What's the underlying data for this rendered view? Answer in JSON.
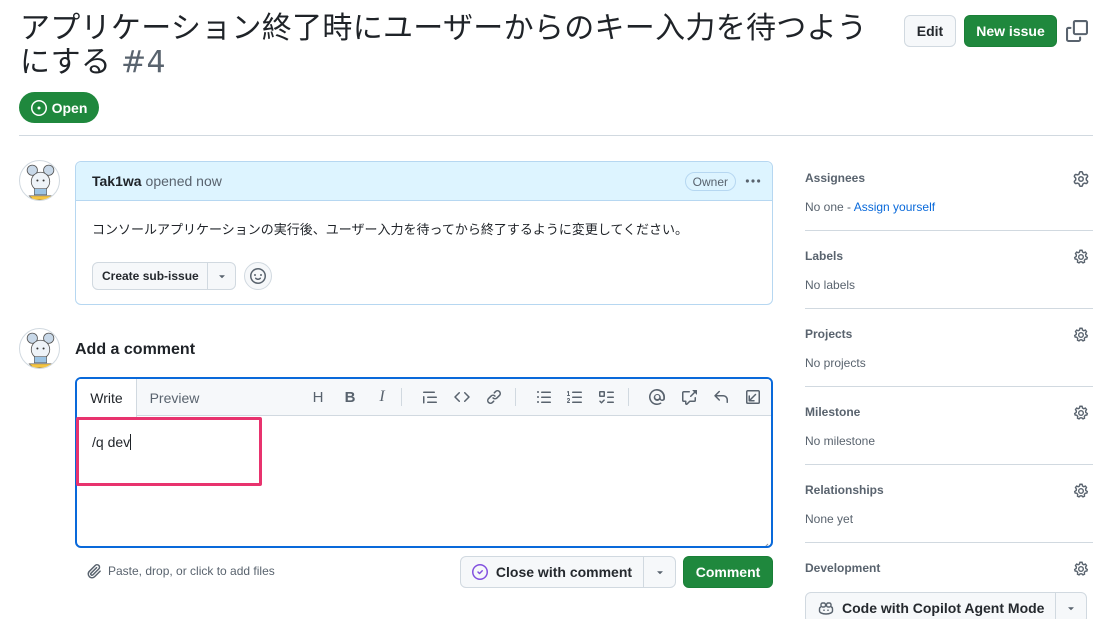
{
  "header": {
    "title": "アプリケーション終了時にユーザーからのキー入力を待つようにする",
    "issue_number": "#4",
    "edit_label": "Edit",
    "new_issue_label": "New issue",
    "state": "Open"
  },
  "comment": {
    "author": "Tak1wa",
    "meta": "opened now",
    "badge": "Owner",
    "body": "コンソールアプリケーションの実行後、ユーザー入力を待ってから終了するように変更してください。",
    "subissue_label": "Create sub-issue"
  },
  "composer": {
    "title": "Add a comment",
    "tabs": [
      "Write",
      "Preview"
    ],
    "toolbar_heading": "H",
    "toolbar_bold": "B",
    "toolbar_italic": "I",
    "text": "/q dev",
    "attach_hint": "Paste, drop, or click to add files",
    "close_label": "Close with comment",
    "comment_label": "Comment"
  },
  "sidebar": {
    "assignees": {
      "label": "Assignees",
      "value": "No one - ",
      "link": "Assign yourself"
    },
    "labels": {
      "label": "Labels",
      "value": "No labels"
    },
    "projects": {
      "label": "Projects",
      "value": "No projects"
    },
    "milestone": {
      "label": "Milestone",
      "value": "No milestone"
    },
    "relationships": {
      "label": "Relationships",
      "value": "None yet"
    },
    "development": {
      "label": "Development",
      "button": "Code with Copilot Agent Mode"
    }
  },
  "colors": {
    "accent": "#0969da",
    "primary": "#1f883d",
    "highlight": "#e8336e"
  }
}
